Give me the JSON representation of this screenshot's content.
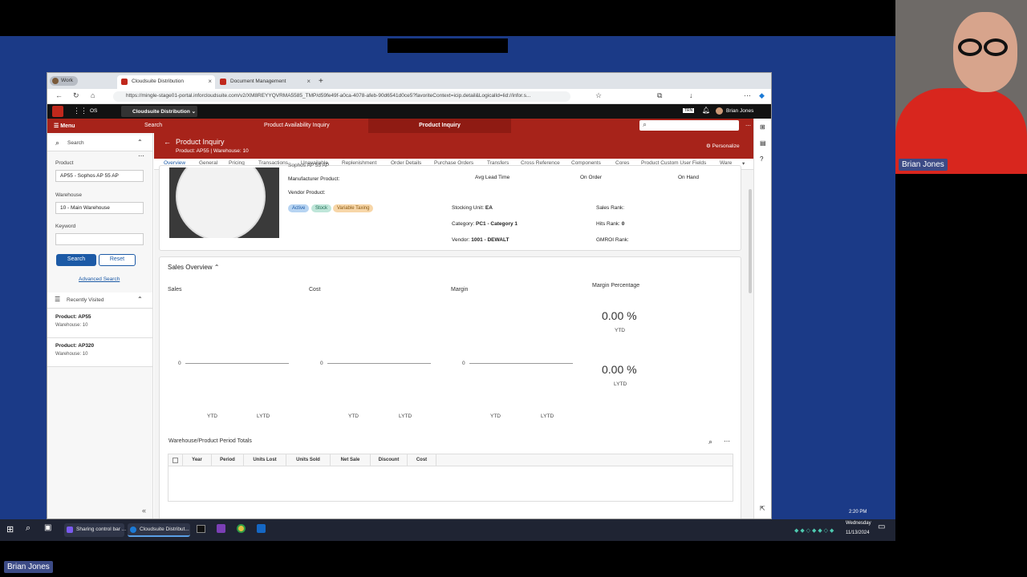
{
  "browser": {
    "tabs": [
      {
        "label": "Work"
      },
      {
        "label": "Cloudsuite Distribution"
      },
      {
        "label": "Document Management"
      }
    ],
    "url": "https://mingle-stage01-portal.inforcloudsuite.com/v2/XM8REYYQVRMA5585_TMP/d59fe49f-a0ca-4078-afeb-90d6541d0ce5?favoriteContext=icip.detail&LogicalId=lid://infor.s..."
  },
  "appbar": {
    "os": "OS",
    "app": "Cloudsuite Distribution",
    "user": "Brian Jones",
    "env": "TRN"
  },
  "nav": {
    "menu": "Menu",
    "search": "Search",
    "availability": "Product Availability Inquiry",
    "inquiry": "Product Inquiry"
  },
  "sidebar": {
    "search_title": "Search",
    "product_label": "Product",
    "product_value": "AP55 - Sophos AP 55 AP",
    "warehouse_label": "Warehouse",
    "warehouse_value": "10 - Main Warehouse",
    "keyword_label": "Keyword",
    "search_btn": "Search",
    "reset_btn": "Reset",
    "advanced": "Advanced Search",
    "recent_title": "Recently Visited",
    "recent": [
      {
        "product": "Product: AP55",
        "warehouse": "Warehouse: 10"
      },
      {
        "product": "Product: AP320",
        "warehouse": "Warehouse: 10"
      }
    ]
  },
  "header": {
    "title": "Product Inquiry",
    "subtitle": "Product: AP55 | Warehouse: 10",
    "personalize": "Personalize"
  },
  "tabs": [
    "Overview",
    "General",
    "Pricing",
    "Transactions",
    "Unavailable",
    "Replenishment",
    "Order Details",
    "Purchase Orders",
    "Transfers",
    "Cross Reference",
    "Components",
    "Cores",
    "Product Custom User Fields",
    "Ware"
  ],
  "product": {
    "desc_cut": "Sophos AP 55 AP",
    "manufacturer": "Manufacturer Product:",
    "vendor_product": "Vendor Product:",
    "chips": [
      "Active",
      "Stock",
      "Variable Taxing"
    ],
    "avg_lead": "Avg Lead Time",
    "on_order": "On Order",
    "on_hand": "On Hand",
    "stocking_label": "Stocking Unit:",
    "stocking": "EA",
    "sales_rank": "Sales Rank:",
    "category_label": "Category:",
    "category": "PC1 - Category 1",
    "hits_label": "Hits Rank:",
    "hits": "0",
    "vendor_label": "Vendor:",
    "vendor": "1001 - DEWALT",
    "gmroi": "GMROI Rank:"
  },
  "overview": {
    "title": "Sales Overview",
    "sales": "Sales",
    "cost": "Cost",
    "margin": "Margin",
    "margin_pct": "Margin Percentage",
    "zero": "0",
    "ytd": "YTD",
    "lytd": "LYTD",
    "pct_ytd": "0.00 %",
    "pct_lytd": "0.00 %"
  },
  "totals": {
    "title": "Warehouse/Product Period Totals",
    "cols": [
      "Year",
      "Period",
      "Units Lost",
      "Units Sold",
      "Net Sale",
      "Discount",
      "Cost"
    ]
  },
  "taskbar": {
    "share": "Sharing control bar ...",
    "app": "Cloudsuite Distribut...",
    "time": "2:20 PM",
    "day": "Wednesday",
    "date": "11/13/2024"
  },
  "participants": {
    "cam_name": "Brian Jones",
    "self_name": "Brian Jones"
  },
  "colors": {
    "brand_red": "#a7231a",
    "accent_blue": "#1c5aa6",
    "stage_blue": "#1b3a87"
  }
}
